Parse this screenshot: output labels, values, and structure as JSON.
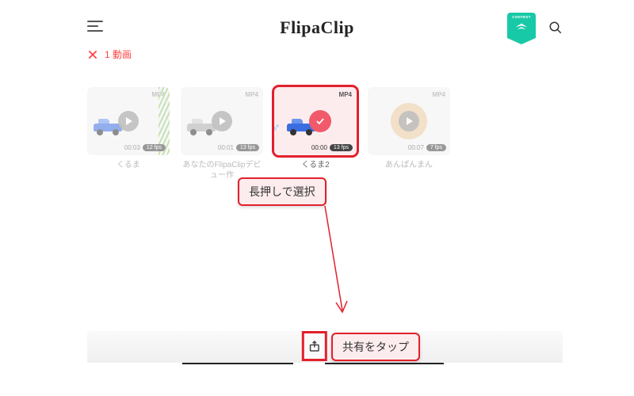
{
  "header": {
    "logo": "FlipaClip",
    "badge_label": "CONTEST"
  },
  "selection": {
    "count_label": "1 動画"
  },
  "cards": [
    {
      "fmt": "MP4",
      "duration": "00:03",
      "fps": "12 fps",
      "title": "くるま"
    },
    {
      "fmt": "MP4",
      "duration": "00:01",
      "fps": "13 fps",
      "title": "あなたのFlipaClipデビュー作"
    },
    {
      "fmt": "MP4",
      "duration": "00:00",
      "fps": "13 fps",
      "title": "くるま2"
    },
    {
      "fmt": "MP4",
      "duration": "00:07",
      "fps": "7 fps",
      "title": "あんぱんまん"
    }
  ],
  "annotations": {
    "long_press": "長押しで選択",
    "tap_share": "共有をタップ"
  },
  "colors": {
    "accent_red": "#e2202c",
    "badge_teal": "#18c9a7"
  }
}
